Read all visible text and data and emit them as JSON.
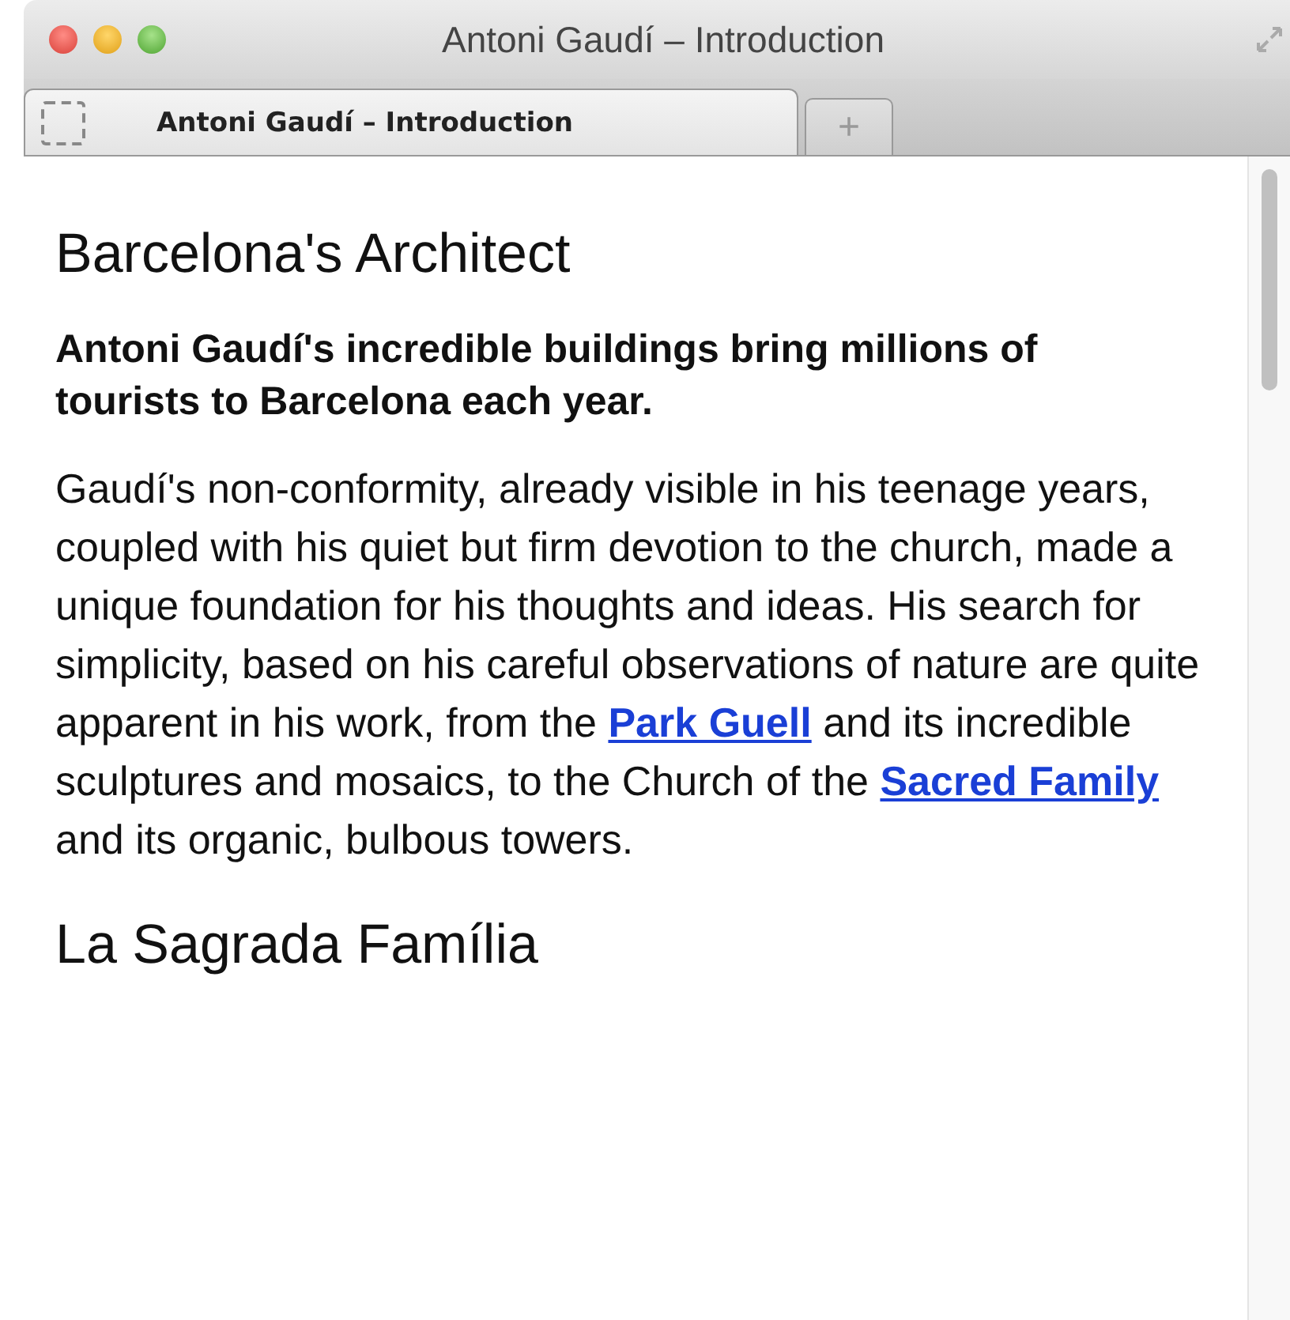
{
  "window": {
    "title": "Antoni Gaudí – Introduction"
  },
  "tabs": [
    {
      "label": "Antoni Gaudí – Introduction",
      "selected": true
    }
  ],
  "new_tab": {
    "label": "+"
  },
  "content": [
    {
      "kind": "heading",
      "text": "Barcelona's Architect"
    },
    {
      "kind": "lead",
      "text": "Antoni Gaudí's incredible buildings bring millions of tourists to Barcelona each year."
    },
    {
      "kind": "paragraph",
      "parts": [
        {
          "kind": "text",
          "text": "Gaudí's non-conformity, already visible in his teenage years, coupled with his quiet but firm devotion to the church, made a unique foundation for his thoughts and ideas. His search for simplicity, based on his careful observations of nature are quite apparent in his work, from the "
        },
        {
          "kind": "link",
          "text": "Park Guell"
        },
        {
          "kind": "text",
          "text": " and its incredible sculptures and mosaics, to the Church of the "
        },
        {
          "kind": "link",
          "text": "Sacred Family"
        },
        {
          "kind": "text",
          "text": " and its organic, bulbous towers."
        }
      ]
    },
    {
      "kind": "heading",
      "text": "La Sagrada Família"
    }
  ]
}
